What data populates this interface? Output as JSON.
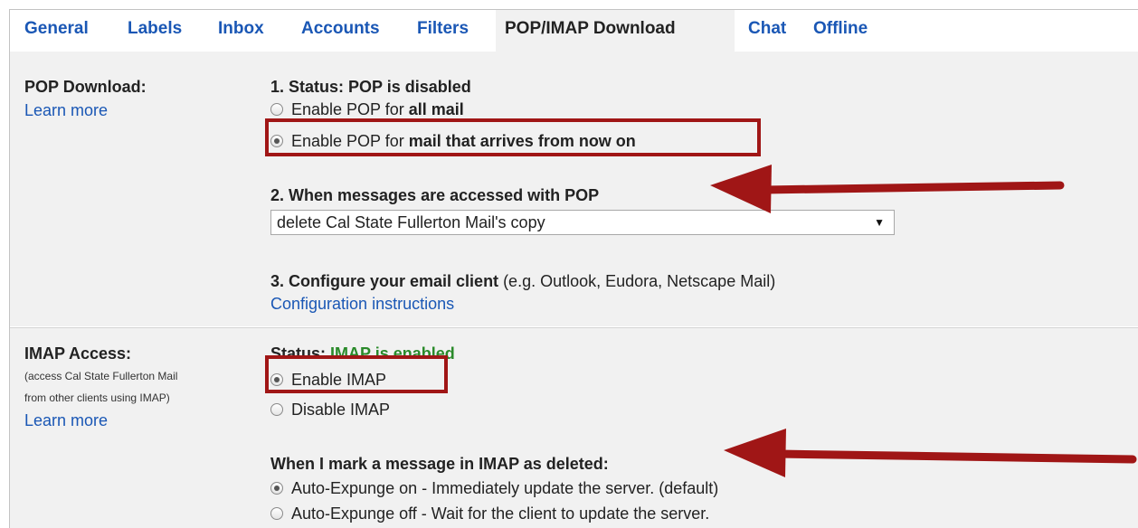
{
  "tabs": [
    {
      "label": "General",
      "active": false
    },
    {
      "label": "Labels",
      "active": false
    },
    {
      "label": "Inbox",
      "active": false
    },
    {
      "label": "Accounts",
      "active": false
    },
    {
      "label": "Filters",
      "active": false
    },
    {
      "label": "POP/IMAP Download",
      "active": true
    },
    {
      "label": "Chat",
      "active": false
    },
    {
      "label": "Offline",
      "active": false
    }
  ],
  "pop": {
    "title": "POP Download:",
    "learn_more": "Learn more",
    "status_heading": "1. Status: POP is disabled",
    "option_all_prefix": "Enable POP for ",
    "option_all_bold": "all mail",
    "option_now_prefix": "Enable POP for ",
    "option_now_bold": "mail that arrives from now on",
    "selected_option": "mail that arrives from now on",
    "access_heading": "2. When messages are accessed with POP",
    "access_select_value": "delete Cal State Fullerton Mail's copy",
    "configure_heading": "3. Configure your email client",
    "configure_note": " (e.g. Outlook, Eudora, Netscape Mail)",
    "configure_link": "Configuration instructions"
  },
  "imap": {
    "title": "IMAP Access:",
    "note_line1": "(access Cal State Fullerton Mail",
    "note_line2": "from other clients using IMAP)",
    "learn_more": "Learn more",
    "status_label": "Status: ",
    "status_value": "IMAP is enabled",
    "enable_label": "Enable IMAP",
    "disable_label": "Disable IMAP",
    "selected_option": "Enable IMAP",
    "delete_heading": "When I mark a message in IMAP as deleted:",
    "expunge_on": "Auto-Expunge on - Immediately update the server. (default)",
    "expunge_off": "Auto-Expunge off - Wait for the client to update the server.",
    "selected_expunge": "Auto-Expunge on"
  },
  "colors": {
    "link": "#1a57b5",
    "section_bg": "#f1f1f1",
    "highlight": "#a01616",
    "status_green": "#2a8a2a"
  }
}
